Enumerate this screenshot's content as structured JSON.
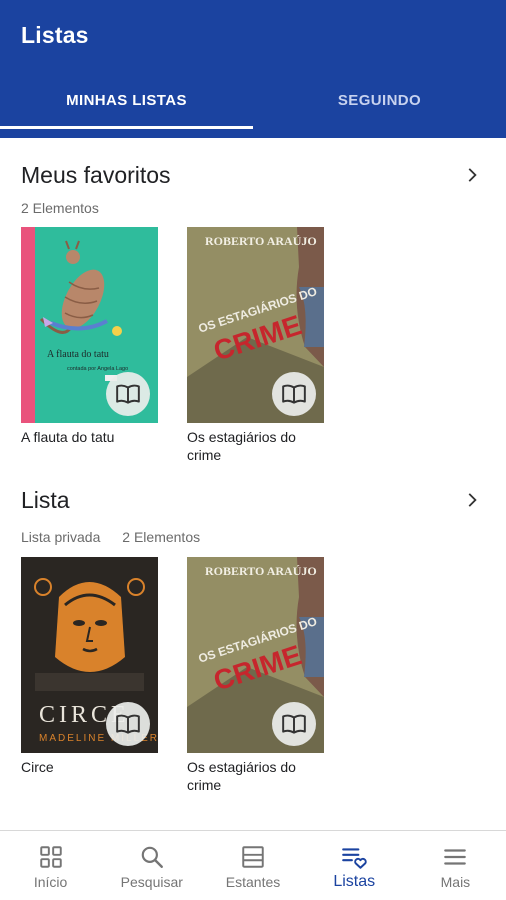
{
  "header": {
    "title": "Listas"
  },
  "tabs": [
    {
      "label": "MINHAS LISTAS",
      "active": true
    },
    {
      "label": "SEGUINDO",
      "active": false
    }
  ],
  "lists": [
    {
      "title": "Meus favoritos",
      "meta": [
        "2 Elementos"
      ],
      "books": [
        {
          "title": "A flauta do tatu",
          "cover_text": [
            "A flauta do tatu",
            "contada por Angela Lago"
          ]
        },
        {
          "title": "Os estagiários do crime",
          "cover_text": [
            "ROBERTO ARAÚJO",
            "OS ESTAGIÁRIOS DO",
            "CRIME"
          ]
        }
      ]
    },
    {
      "title": "Lista",
      "meta": [
        "Lista privada",
        "2 Elementos"
      ],
      "books": [
        {
          "title": "Circe",
          "cover_text": [
            "CIRCE",
            "MADELINE MILLER"
          ]
        },
        {
          "title": "Os estagiários do crime",
          "cover_text": [
            "ROBERTO ARAÚJO",
            "OS ESTAGIÁRIOS DO",
            "CRIME"
          ]
        }
      ]
    }
  ],
  "bottom_nav": [
    {
      "label": "Início",
      "icon": "grid-icon",
      "active": false
    },
    {
      "label": "Pesquisar",
      "icon": "search-icon",
      "active": false
    },
    {
      "label": "Estantes",
      "icon": "shelf-icon",
      "active": false
    },
    {
      "label": "Listas",
      "icon": "list-heart-icon",
      "active": true
    },
    {
      "label": "Mais",
      "icon": "menu-icon",
      "active": false
    }
  ],
  "colors": {
    "primary": "#1b43a0",
    "inactive_tab": "#c7d2ef",
    "nav_inactive": "#757575"
  }
}
